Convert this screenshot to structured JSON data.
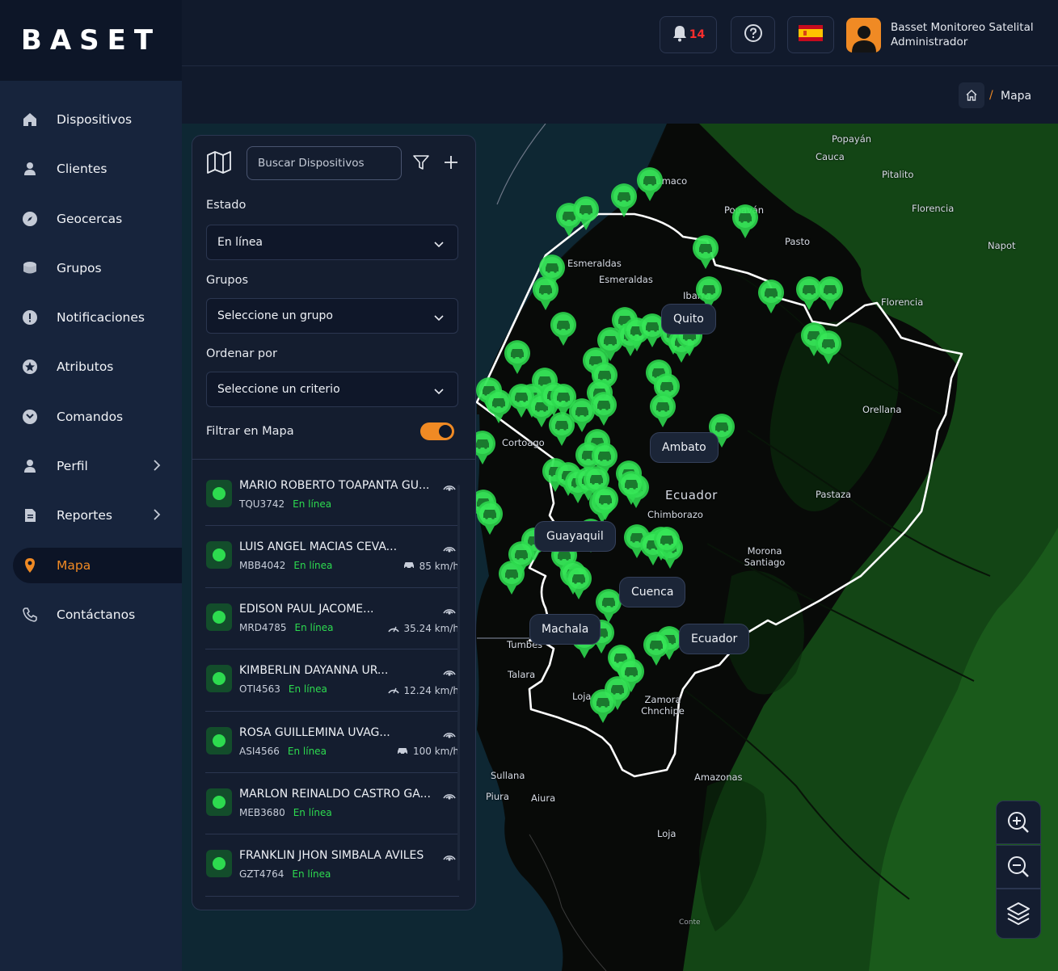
{
  "brand": {
    "logo_text": "BASET"
  },
  "sidebar": {
    "items": [
      {
        "label": "Dispositivos",
        "icon": "home-icon"
      },
      {
        "label": "Clientes",
        "icon": "user-icon"
      },
      {
        "label": "Geocercas",
        "icon": "compass-icon"
      },
      {
        "label": "Grupos",
        "icon": "stack-icon"
      },
      {
        "label": "Notificaciones",
        "icon": "alert-icon"
      },
      {
        "label": "Atributos",
        "icon": "star-icon"
      },
      {
        "label": "Comandos",
        "icon": "command-icon"
      },
      {
        "label": "Perfil",
        "icon": "user-icon"
      },
      {
        "label": "Reportes",
        "icon": "report-icon"
      },
      {
        "label": "Mapa",
        "icon": "location-pin-icon"
      },
      {
        "label": "Contáctanos",
        "icon": "phone-icon"
      }
    ]
  },
  "header": {
    "notification_count": "14",
    "user_name": "Basset Monitoreo Satelital",
    "user_role": "Administrador"
  },
  "breadcrumb": {
    "separator": "/",
    "current": "Mapa"
  },
  "panel": {
    "search_placeholder": "Buscar Dispositivos",
    "estado_label": "Estado",
    "estado_value": "En línea",
    "grupos_label": "Grupos",
    "grupos_value": "Seleccione un grupo",
    "ordenar_label": "Ordenar por",
    "ordenar_value": "Seleccione un criterio",
    "filtrar_label": "Filtrar en Mapa",
    "filtrar_on": true,
    "devices": [
      {
        "name": "MARIO ROBERTO TOAPANTA GU...",
        "plate": "TQU3742",
        "status": "En línea",
        "speed": ""
      },
      {
        "name": "LUIS ANGEL MACIAS CEVA...",
        "plate": "MBB4042",
        "status": "En línea",
        "speed": "85 km/h"
      },
      {
        "name": "EDISON PAUL JACOME...",
        "plate": "MRD4785",
        "status": "En línea",
        "speed": "35.24 km/h"
      },
      {
        "name": "KIMBERLIN DAYANNA UR...",
        "plate": "OTI4563",
        "status": "En línea",
        "speed": "12.24 km/h"
      },
      {
        "name": "ROSA GUILLEMINA UVAG...",
        "plate": "ASI4566",
        "status": "En línea",
        "speed": "100 km/h"
      },
      {
        "name": "MARLON REINALDO CASTRO GA...",
        "plate": "MEB3680",
        "status": "En línea",
        "speed": ""
      },
      {
        "name": "FRANKLIN JHON SIMBALA AVILES",
        "plate": "GZT4764",
        "status": "En línea",
        "speed": ""
      }
    ]
  },
  "map": {
    "city_pills": [
      "Quito",
      "Ambato",
      "Guayaquil",
      "Cuenca",
      "Machala",
      "Ecuador"
    ],
    "places": [
      "Popayán",
      "Cauca",
      "Pitalito",
      "Tumaco",
      "Popayán",
      "Florencia",
      "Pasto",
      "Napot",
      "Esmeraldas",
      "Esmeraldas",
      "Ibarra",
      "Florencia",
      "Orellana",
      "Ecuador",
      "Chimborazo",
      "Pastaza",
      "Morona Santiago",
      "Cortoago",
      "Tumbes",
      "Talara",
      "Loja",
      "Zamora Chnchipe",
      "Sullana",
      "Piura",
      "Aiura",
      "Amazonas",
      "Loja",
      "Conte"
    ],
    "accent": "#f08a24",
    "marker_color": "#2ddb4f"
  }
}
